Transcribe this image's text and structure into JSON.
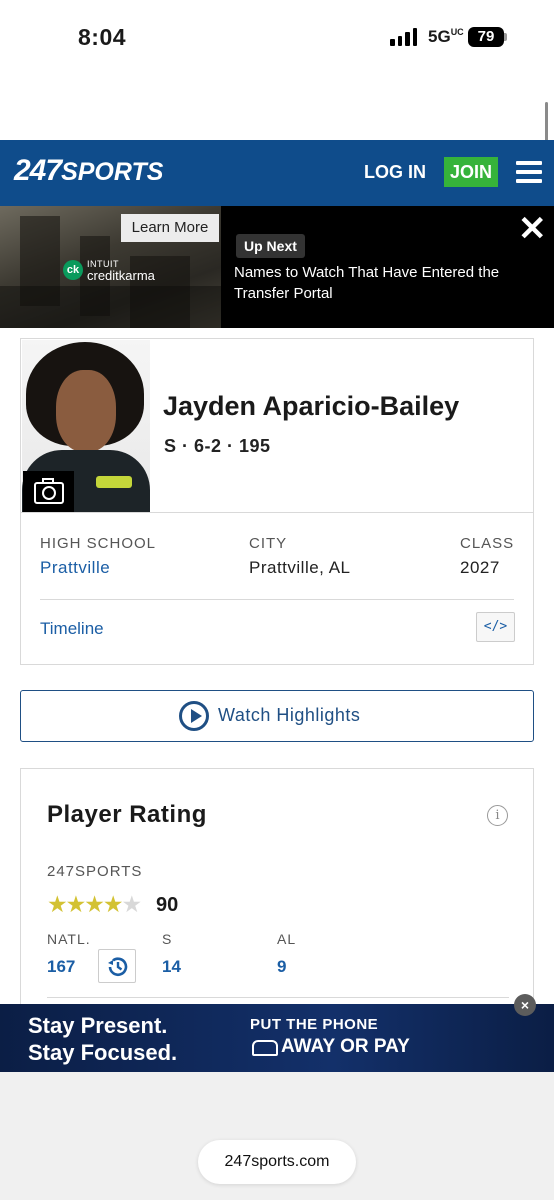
{
  "status": {
    "time": "8:04",
    "network": "5G",
    "network_suffix": "UC",
    "battery": "79"
  },
  "header": {
    "logo_num": "247",
    "logo_text": "SPORTS",
    "login": "LOG IN",
    "join": "JOIN",
    "brand_color": "#0f4c8b",
    "join_color": "#36b33a"
  },
  "ad_banner": {
    "learn_more": "Learn More",
    "advertiser_top": "INTUIT",
    "advertiser": "creditkarma",
    "advertiser_badge": "ck",
    "up_next_tag": "Up Next",
    "up_next_title": "Names to Watch That Have Entered the Transfer Portal",
    "close_icon": "close-icon"
  },
  "player": {
    "name": "Jayden Aparicio-Bailey",
    "meta": "S · 6-2 · 195",
    "high_school_label": "HIGH SCHOOL",
    "high_school": "Prattville",
    "city_label": "CITY",
    "city": "Prattville, AL",
    "class_label": "CLASS",
    "class": "2027",
    "timeline": "Timeline",
    "embed_label": "</>"
  },
  "watch": {
    "label": "Watch Highlights"
  },
  "rating": {
    "title": "Player Rating",
    "info": "i",
    "source": "247SPORTS",
    "stars_filled": 4,
    "stars_total": 5,
    "score": "90",
    "natl_label": "NATL.",
    "natl": "167",
    "pos_label": "S",
    "pos": "14",
    "state_label": "AL",
    "state": "9"
  },
  "bottom_ad": {
    "line1": "Stay Present.",
    "line2": "Stay Focused.",
    "right1": "PUT THE PHONE",
    "right2": "AWAY OR PAY",
    "close": "×"
  },
  "browser": {
    "url": "247sports.com"
  }
}
